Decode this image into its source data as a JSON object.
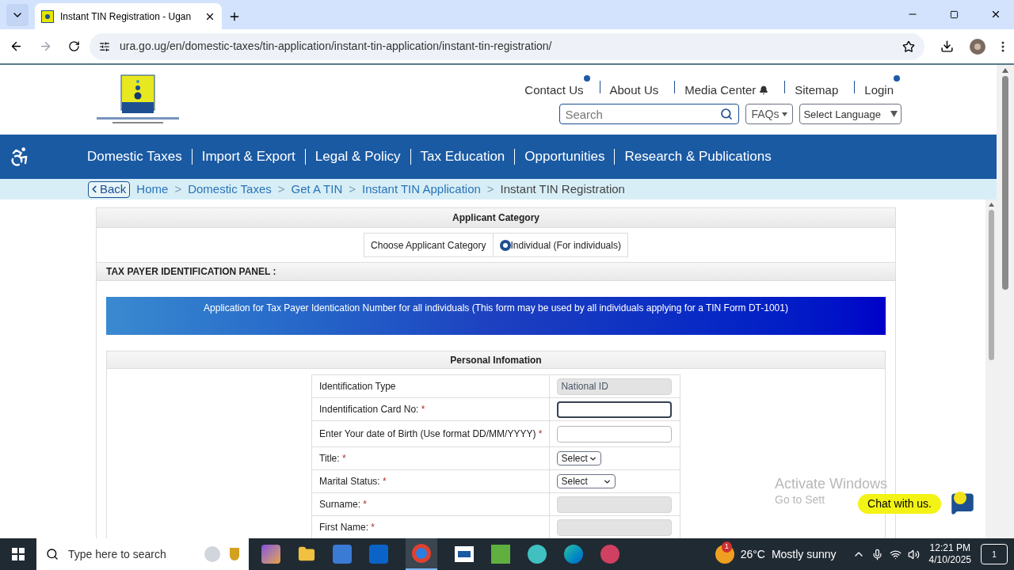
{
  "browser": {
    "tab_title": "Instant TIN Registration - Ugan",
    "url": "ura.go.ug/en/domestic-taxes/tin-application/instant-tin-application/instant-tin-registration/"
  },
  "header": {
    "top_links": [
      {
        "label": "Contact Us",
        "dot": true,
        "bell": false
      },
      {
        "label": "About Us",
        "dot": false,
        "bell": false
      },
      {
        "label": "Media Center",
        "dot": false,
        "bell": true
      },
      {
        "label": "Sitemap",
        "dot": false,
        "bell": false
      },
      {
        "label": "Login",
        "dot": true,
        "bell": false
      }
    ],
    "search_placeholder": "Search",
    "faqs": "FAQs",
    "language": "Select Language"
  },
  "nav": {
    "items": [
      "Domestic Taxes",
      "Import & Export",
      "Legal & Policy",
      "Tax Education",
      "Opportunities",
      "Research & Publications"
    ]
  },
  "breadcrumb": {
    "back": "Back",
    "items": [
      "Home",
      "Domestic Taxes",
      "Get A TIN",
      "Instant TIN Application",
      "Instant TIN Registration"
    ],
    "separator": ">"
  },
  "form": {
    "category_title": "Applicant Category",
    "choose_label": "Choose Applicant Category",
    "option": {
      "label": "Individual (For individuals)",
      "selected": true
    },
    "panel_title": "TAX PAYER IDENTIFICATION PANEL :",
    "banner": "Application for Tax Payer Identication Number for all individuals (This form may be used by all individuals applying for a TIN Form DT-1001)",
    "section_title": "Personal Infomation",
    "fields": [
      {
        "label": "Identification Type",
        "kind": "input",
        "value": "National ID",
        "disabled": true,
        "focused": false
      },
      {
        "label": "Indentification Card No:",
        "mark": "*",
        "kind": "input",
        "disabled": false,
        "focused": true
      },
      {
        "label": "Enter Your date of Birth (Use format DD/MM/YYYY)",
        "mark": "*",
        "kind": "input",
        "disabled": false,
        "focused": false
      },
      {
        "label": "Title:",
        "mark": "*",
        "kind": "select",
        "value": "Select"
      },
      {
        "label": "Marital Status:",
        "mark": "*",
        "kind": "select",
        "value": "Select"
      },
      {
        "label": "Surname:",
        "mark": "*",
        "kind": "input",
        "disabled": true,
        "focused": false
      },
      {
        "label": "First Name:",
        "mark": "*",
        "kind": "input",
        "disabled": true,
        "focused": false
      }
    ]
  },
  "watermark": [
    "Activate Windows",
    "Go to Sett"
  ],
  "chat": "Chat with us.",
  "taskbar": {
    "search_placeholder": "Type here to search",
    "weather_badge": "1",
    "temperature": "26°C",
    "weather": "Mostly sunny",
    "time": "12:21 PM",
    "date": "4/10/2025",
    "notifications": "1"
  }
}
